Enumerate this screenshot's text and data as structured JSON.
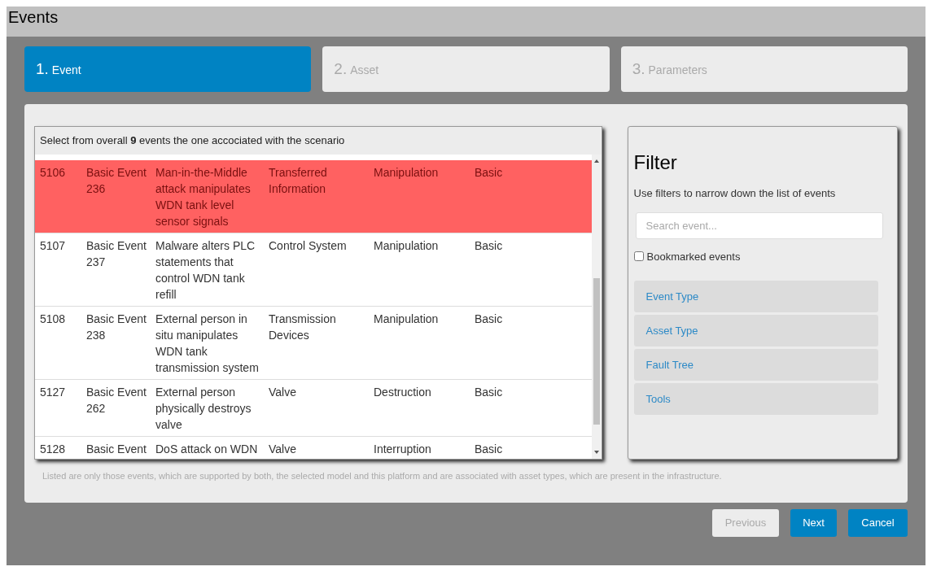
{
  "window": {
    "title": "Events"
  },
  "steps": [
    {
      "number": "1.",
      "label": "Event",
      "selected": true
    },
    {
      "number": "2.",
      "label": "Asset",
      "selected": false
    },
    {
      "number": "3.",
      "label": "Parameters",
      "selected": false
    }
  ],
  "table": {
    "caption": "Select from overall **9** events the one accociated with the scenario",
    "rows": [
      {
        "id": "5106",
        "name": "Basic Event 236",
        "description": "Man-in-the-Middle attack manipulates WDN tank level sensor signals",
        "asset": "Transferred Information",
        "type": "Manipulation",
        "level": "Basic",
        "selected": true
      },
      {
        "id": "5107",
        "name": "Basic Event 237",
        "description": "Malware alters PLC statements that control WDN tank refill",
        "asset": "Control System",
        "type": "Manipulation",
        "level": "Basic",
        "selected": false
      },
      {
        "id": "5108",
        "name": "Basic Event 238",
        "description": "External person in situ manipulates WDN tank transmission system",
        "asset": "Transmission Devices",
        "type": "Manipulation",
        "level": "Basic",
        "selected": false
      },
      {
        "id": "5127",
        "name": "Basic Event 262",
        "description": "External person physically destroys valve",
        "asset": "Valve",
        "type": "Destruction",
        "level": "Basic",
        "selected": false
      },
      {
        "id": "5128",
        "name": "Basic Event",
        "description": "DoS attack on WDN",
        "asset": "Valve",
        "type": "Interruption",
        "level": "Basic",
        "selected": false
      }
    ],
    "note": "Listed are only those events, which are supported by both, the selected model and this platform and are associated with asset types, which are present in the infrastructure."
  },
  "filter": {
    "title": "Filter",
    "subtitle": "Use filters to narrow down the list of events",
    "search": {
      "placeholder": "Search event..."
    },
    "bookmarked": {
      "label": "Bookmarked events",
      "checked": false
    },
    "sections": [
      "Event Type",
      "Asset Type",
      "Fault Tree",
      "Tools"
    ]
  },
  "buttons": [
    {
      "label": "Previous",
      "disabled": true
    },
    {
      "label": "Next",
      "disabled": false
    },
    {
      "label": "Cancel",
      "disabled": false
    }
  ]
}
